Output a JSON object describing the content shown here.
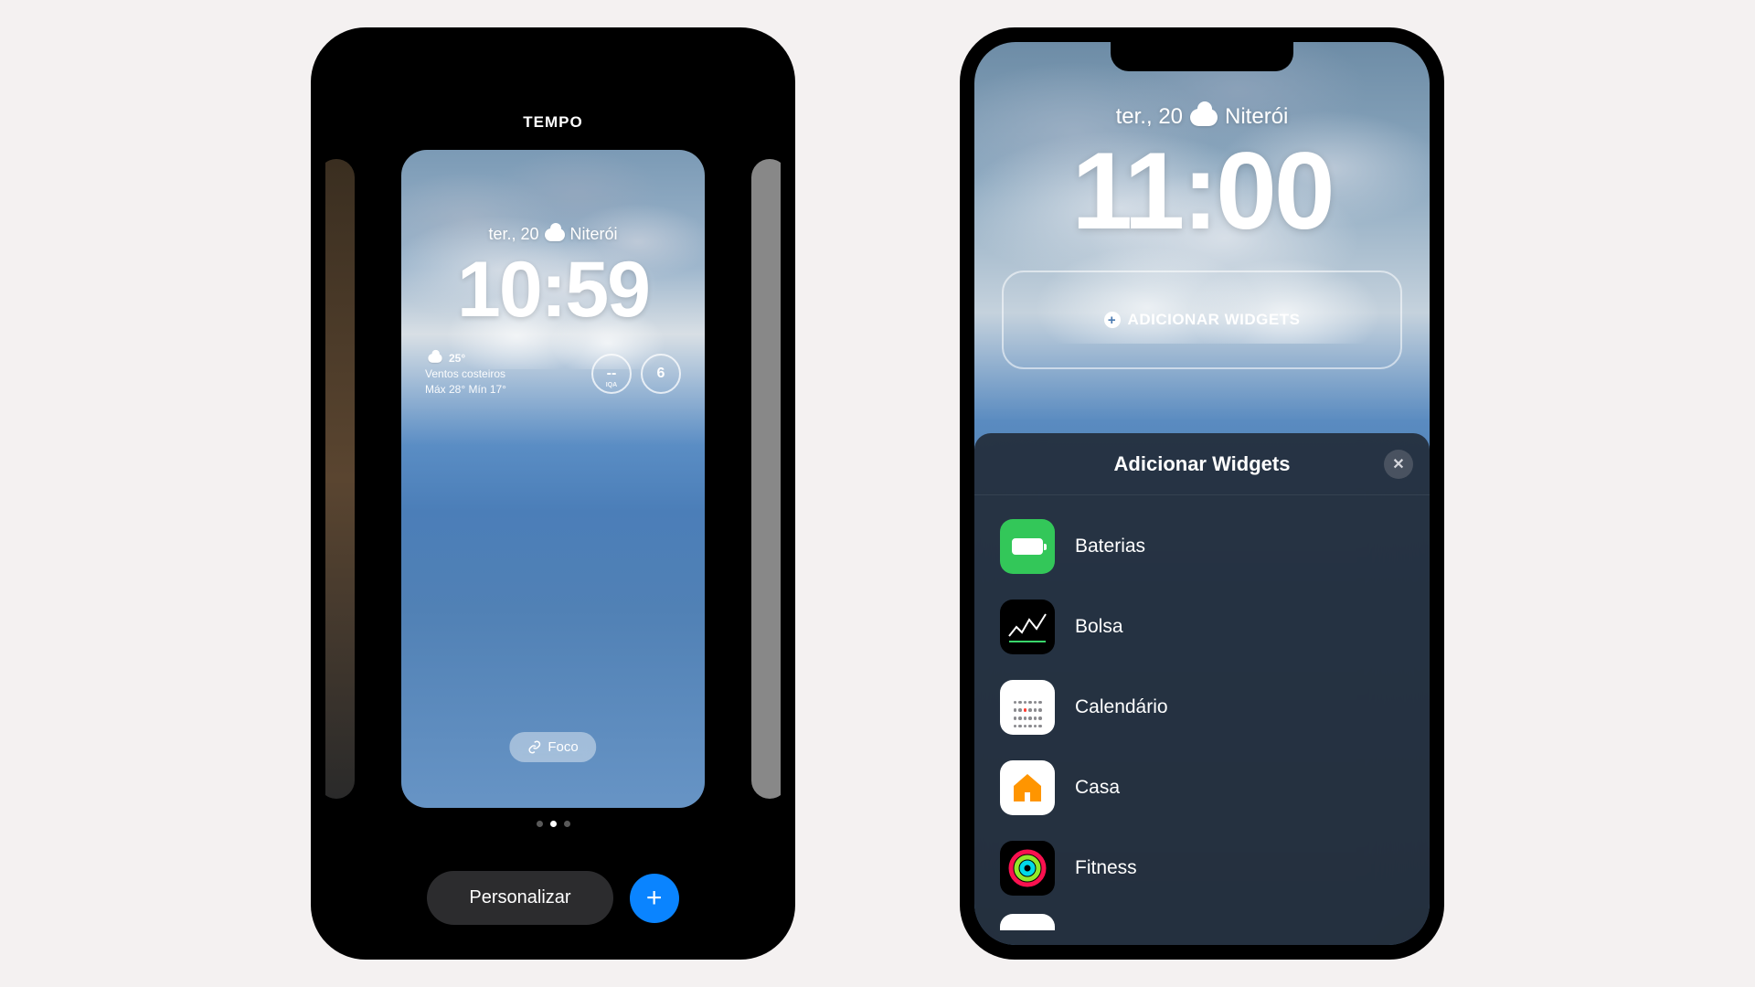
{
  "phone1": {
    "header_label": "TEMPO",
    "date_text": "ter., 20",
    "location": "Niterói",
    "time": "10:59",
    "weather_widget": {
      "temp": "25°",
      "condition": "Ventos costeiros",
      "hilo": "Máx 28° Mín 17°",
      "ring1_value": "--",
      "ring1_label": "IQA",
      "ring2_value": "6"
    },
    "focus_label": "Foco",
    "personalize_label": "Personalizar"
  },
  "phone2": {
    "date_text": "ter., 20",
    "location": "Niterói",
    "time": "11:00",
    "add_widgets_cta": "ADICIONAR WIDGETS",
    "sheet": {
      "title": "Adicionar Widgets",
      "items": [
        {
          "name": "Baterias"
        },
        {
          "name": "Bolsa"
        },
        {
          "name": "Calendário"
        },
        {
          "name": "Casa"
        },
        {
          "name": "Fitness"
        }
      ]
    }
  }
}
